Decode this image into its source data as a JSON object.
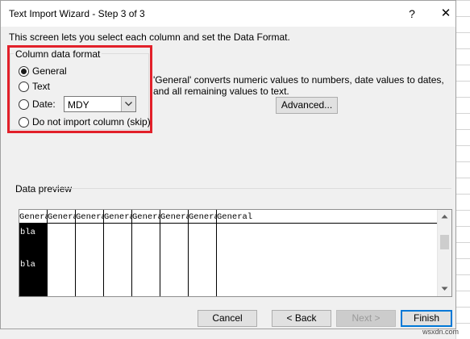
{
  "window": {
    "title": "Text Import Wizard - Step 3 of 3",
    "help_glyph": "?",
    "close_glyph": "✕"
  },
  "intro": "This screen lets you select each column and set the Data Format.",
  "column_format": {
    "group_label": "Column data format",
    "options": [
      {
        "label": "General",
        "selected": true
      },
      {
        "label": "Text",
        "selected": false
      },
      {
        "label": "Date:",
        "selected": false
      },
      {
        "label": "Do not import column (skip)",
        "selected": false
      }
    ],
    "date_value": "MDY",
    "highlight_color": "#e2202a"
  },
  "description": "'General' converts numeric values to numbers, date values to dates, and all remaining values to text.",
  "buttons": {
    "advanced": "Advanced...",
    "cancel": "Cancel",
    "back": "< Back",
    "next": "Next >",
    "finish": "Finish"
  },
  "preview": {
    "label": "Data preview",
    "columns": [
      "General",
      "General",
      "General",
      "General",
      "General",
      "General",
      "General",
      "General"
    ],
    "rows": [
      [
        "bla"
      ],
      [
        "bla"
      ]
    ]
  },
  "watermark": "wsxdn.com"
}
